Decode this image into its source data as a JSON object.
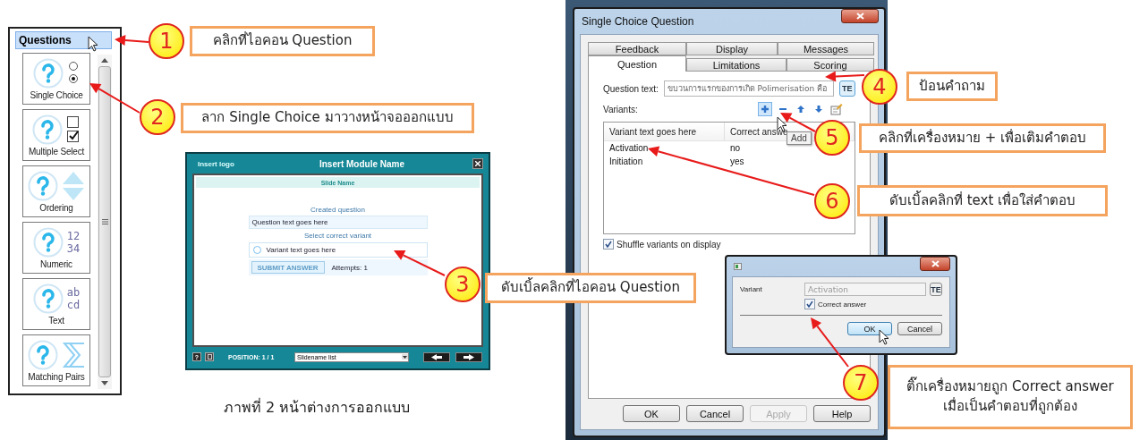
{
  "question_panel": {
    "title": "Questions",
    "title_selected": true,
    "items": [
      {
        "label": "Single Choice",
        "kind": "single"
      },
      {
        "label": "Multiple Select",
        "kind": "multiple"
      },
      {
        "label": "Ordering",
        "kind": "ordering"
      },
      {
        "label": "Numeric",
        "kind": "numeric",
        "glyphs": [
          "12",
          "34"
        ]
      },
      {
        "label": "Text",
        "kind": "text",
        "glyphs": [
          "ab",
          "cd"
        ]
      },
      {
        "label": "Matching Pairs",
        "kind": "matching"
      }
    ]
  },
  "callouts": [
    {
      "number": "1",
      "lines": [
        "คลิกที่ไอคอน Question"
      ]
    },
    {
      "number": "2",
      "lines": [
        "ลาก Single Choice มาวางหน้าจอออกแบบ"
      ]
    },
    {
      "number": "3",
      "lines": [
        "ดับเบิ้ลคลิกที่ไอคอน Question"
      ]
    },
    {
      "number": "4",
      "lines": [
        "ป้อนคำถาม"
      ]
    },
    {
      "number": "5",
      "lines": [
        "คลิกที่เครื่องหมาย + เพื่อเติมคำตอบ"
      ]
    },
    {
      "number": "6",
      "lines": [
        "ดับเบิ้ลคลิกที่ text เพื่อใส่คำตอบ"
      ]
    },
    {
      "number": "7",
      "lines": [
        "ติ๊กเครื่องหมายถูก Correct answer",
        "เมื่อเป็นคำตอบที่ถูกต้อง"
      ]
    }
  ],
  "preview_window": {
    "logo": "Insert logo",
    "title": "Insert Module Name",
    "slide_name": "Slide Name",
    "prompt": "Created question",
    "question": "Question text goes here",
    "instruction": "Select correct variant",
    "variant": {
      "label": "Variant text goes here",
      "selected": false
    },
    "submit": {
      "label": "SUBMIT ANSWER",
      "disabled": true
    },
    "attempts": "Attempts: 1",
    "help": "?",
    "position": "POSITION: 1 / 1",
    "slide_list": "Slidename list"
  },
  "caption": "ภาพที่ 2 หน้าต่างการออกแบบ",
  "dialog": {
    "title": "Single Choice Question",
    "tab_rows": [
      [
        {
          "label": "Feedback",
          "selected": false
        },
        {
          "label": "Display",
          "selected": false
        },
        {
          "label": "Messages",
          "selected": false
        }
      ],
      [
        {
          "label": "Question",
          "selected": true
        },
        {
          "label": "Limitations",
          "selected": false
        },
        {
          "label": "Scoring",
          "selected": false
        }
      ]
    ],
    "question_label": "Question text:",
    "question_value": "ขบวนการแรกของการเกิด Polimerisation คือ",
    "te": "TE",
    "variants_label": "Variants:",
    "toolbar": [
      {
        "kind": "add",
        "selected": true
      },
      {
        "kind": "remove",
        "selected": false
      },
      {
        "kind": "up",
        "selected": false
      },
      {
        "kind": "down",
        "selected": false
      },
      {
        "kind": "edit",
        "selected": false
      }
    ],
    "tooltip": "Add",
    "columns": [
      "Variant text goes here",
      "Correct answe"
    ],
    "rows": [
      [
        "Activation",
        "no"
      ],
      [
        "Initiation",
        "yes"
      ]
    ],
    "shuffle": {
      "label": "Shuffle variants on display",
      "checked": true
    },
    "buttons": [
      {
        "label": "OK",
        "disabled": false
      },
      {
        "label": "Cancel",
        "disabled": false
      },
      {
        "label": "Apply",
        "disabled": true
      },
      {
        "label": "Help",
        "disabled": false
      }
    ]
  },
  "variant_dialog": {
    "label": "Variant",
    "value": "Activation",
    "te": "TE",
    "correct": {
      "label": "Correct answer",
      "checked": true
    },
    "buttons": [
      {
        "label": "OK",
        "default": true
      },
      {
        "label": "Cancel",
        "default": false
      }
    ]
  }
}
